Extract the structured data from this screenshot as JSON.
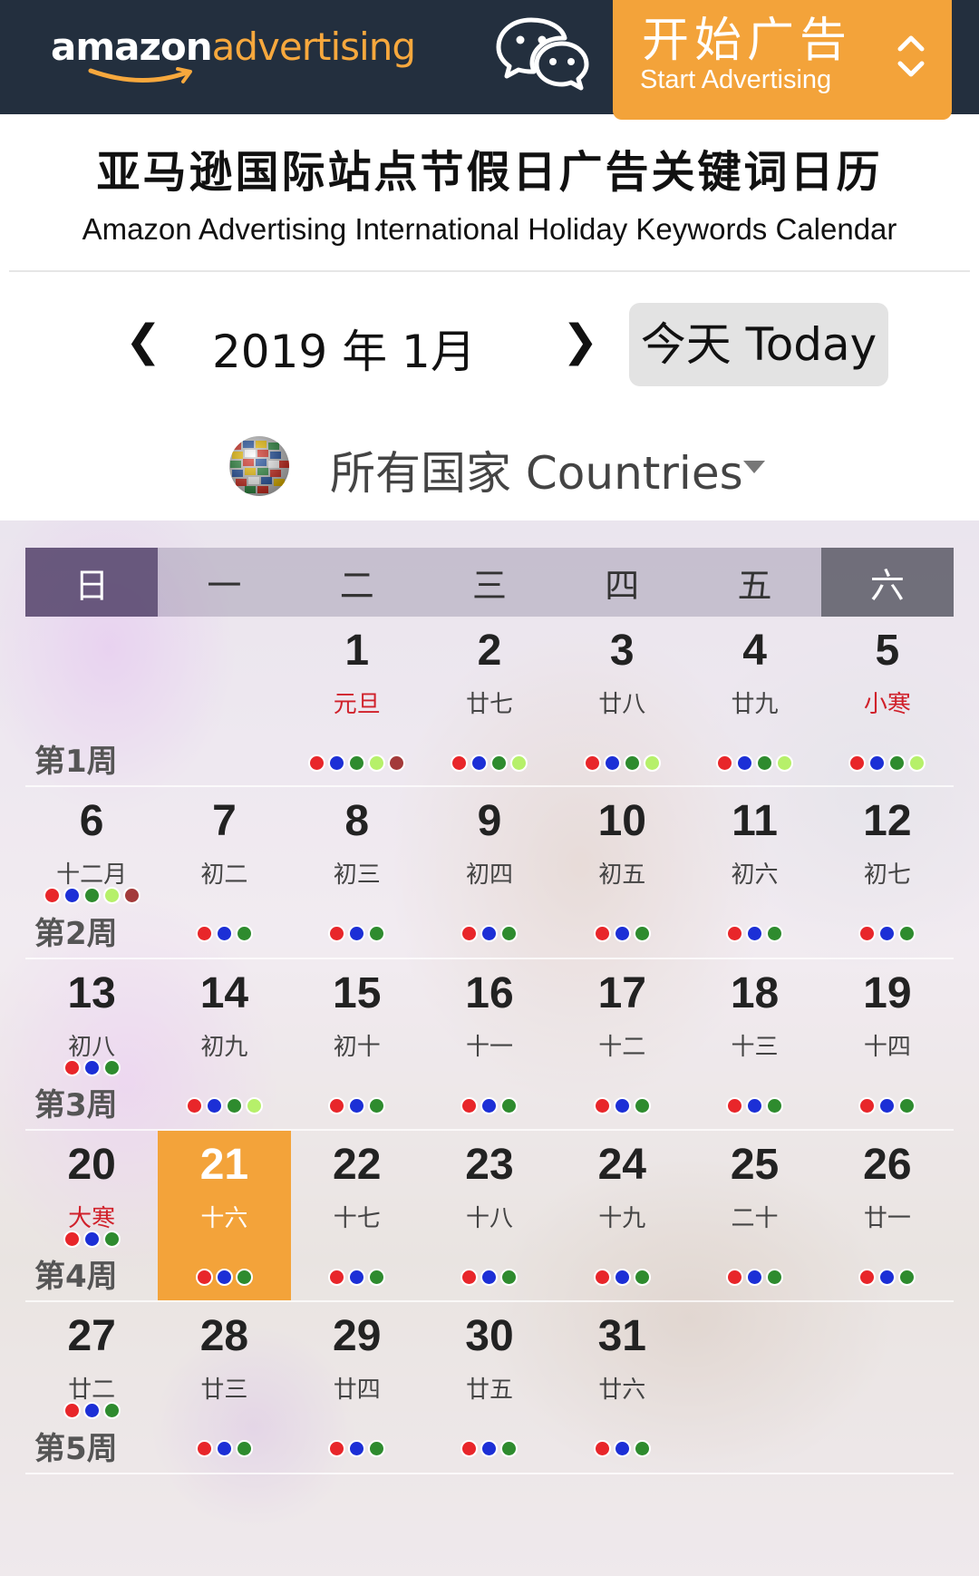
{
  "header": {
    "logo_main": "amazon",
    "logo_sub": "advertising",
    "cta_cn": "开始广告",
    "cta_en": "Start Advertising"
  },
  "title": {
    "cn": "亚马逊国际站点节假日广告关键词日历",
    "en": "Amazon Advertising International Holiday Keywords Calendar"
  },
  "nav": {
    "prev": "❮",
    "month": "2019 年 1月",
    "next": "❯",
    "today": "今天 Today"
  },
  "country": {
    "label": "所有国家 Countries"
  },
  "colors": {
    "red": "#e8262a",
    "blue": "#1c2fd6",
    "green": "#2e8b2e",
    "lime": "#b6f06a",
    "maroon": "#a33a3a",
    "accent": "#f3a33a"
  },
  "calendar": {
    "weekdays": [
      "日",
      "一",
      "二",
      "三",
      "四",
      "五",
      "六"
    ],
    "weeks": [
      {
        "label": "第1周",
        "days": [
          null,
          null,
          {
            "day": "1",
            "lunar": "元旦",
            "red": true,
            "dots": [
              "red",
              "blue",
              "green",
              "lime",
              "maroon"
            ]
          },
          {
            "day": "2",
            "lunar": "廿七",
            "dots": [
              "red",
              "blue",
              "green",
              "lime"
            ]
          },
          {
            "day": "3",
            "lunar": "廿八",
            "dots": [
              "red",
              "blue",
              "green",
              "lime"
            ]
          },
          {
            "day": "4",
            "lunar": "廿九",
            "dots": [
              "red",
              "blue",
              "green",
              "lime"
            ]
          },
          {
            "day": "5",
            "lunar": "小寒",
            "red": true,
            "dots": [
              "red",
              "blue",
              "green",
              "lime"
            ]
          }
        ]
      },
      {
        "label": "第2周",
        "days": [
          {
            "day": "6",
            "lunar": "十二月",
            "dots": [
              "red",
              "blue",
              "green",
              "lime",
              "maroon"
            ],
            "dots_high": true
          },
          {
            "day": "7",
            "lunar": "初二",
            "dots": [
              "red",
              "blue",
              "green"
            ]
          },
          {
            "day": "8",
            "lunar": "初三",
            "dots": [
              "red",
              "blue",
              "green"
            ]
          },
          {
            "day": "9",
            "lunar": "初四",
            "dots": [
              "red",
              "blue",
              "green"
            ]
          },
          {
            "day": "10",
            "lunar": "初五",
            "dots": [
              "red",
              "blue",
              "green"
            ]
          },
          {
            "day": "11",
            "lunar": "初六",
            "dots": [
              "red",
              "blue",
              "green"
            ]
          },
          {
            "day": "12",
            "lunar": "初七",
            "dots": [
              "red",
              "blue",
              "green"
            ]
          }
        ]
      },
      {
        "label": "第3周",
        "days": [
          {
            "day": "13",
            "lunar": "初八",
            "dots": [
              "red",
              "blue",
              "green"
            ],
            "dots_high": true
          },
          {
            "day": "14",
            "lunar": "初九",
            "dots": [
              "red",
              "blue",
              "green",
              "lime"
            ]
          },
          {
            "day": "15",
            "lunar": "初十",
            "dots": [
              "red",
              "blue",
              "green"
            ]
          },
          {
            "day": "16",
            "lunar": "十一",
            "dots": [
              "red",
              "blue",
              "green"
            ]
          },
          {
            "day": "17",
            "lunar": "十二",
            "dots": [
              "red",
              "blue",
              "green"
            ]
          },
          {
            "day": "18",
            "lunar": "十三",
            "dots": [
              "red",
              "blue",
              "green"
            ]
          },
          {
            "day": "19",
            "lunar": "十四",
            "dots": [
              "red",
              "blue",
              "green"
            ]
          }
        ]
      },
      {
        "label": "第4周",
        "days": [
          {
            "day": "20",
            "lunar": "大寒",
            "red": true,
            "dots": [
              "red",
              "blue",
              "green"
            ],
            "dots_high": true
          },
          {
            "day": "21",
            "lunar": "十六",
            "today": true,
            "dots": [
              "red",
              "blue",
              "green"
            ]
          },
          {
            "day": "22",
            "lunar": "十七",
            "dots": [
              "red",
              "blue",
              "green"
            ]
          },
          {
            "day": "23",
            "lunar": "十八",
            "dots": [
              "red",
              "blue",
              "green"
            ]
          },
          {
            "day": "24",
            "lunar": "十九",
            "dots": [
              "red",
              "blue",
              "green"
            ]
          },
          {
            "day": "25",
            "lunar": "二十",
            "dots": [
              "red",
              "blue",
              "green"
            ]
          },
          {
            "day": "26",
            "lunar": "廿一",
            "dots": [
              "red",
              "blue",
              "green"
            ]
          }
        ]
      },
      {
        "label": "第5周",
        "days": [
          {
            "day": "27",
            "lunar": "廿二",
            "dots": [
              "red",
              "blue",
              "green"
            ],
            "dots_high": true
          },
          {
            "day": "28",
            "lunar": "廿三",
            "dots": [
              "red",
              "blue",
              "green"
            ]
          },
          {
            "day": "29",
            "lunar": "廿四",
            "dots": [
              "red",
              "blue",
              "green"
            ]
          },
          {
            "day": "30",
            "lunar": "廿五",
            "dots": [
              "red",
              "blue",
              "green"
            ]
          },
          {
            "day": "31",
            "lunar": "廿六",
            "dots": [
              "red",
              "blue",
              "green"
            ]
          },
          null,
          null
        ]
      }
    ]
  }
}
